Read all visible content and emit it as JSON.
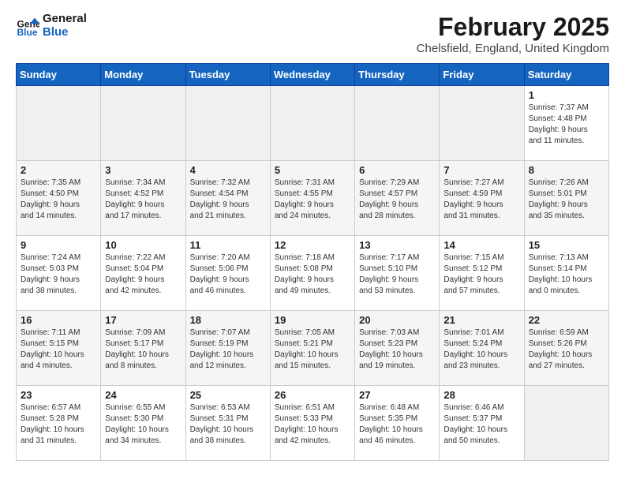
{
  "logo": {
    "line1": "General",
    "line2": "Blue"
  },
  "title": "February 2025",
  "subtitle": "Chelsfield, England, United Kingdom",
  "weekdays": [
    "Sunday",
    "Monday",
    "Tuesday",
    "Wednesday",
    "Thursday",
    "Friday",
    "Saturday"
  ],
  "weeks": [
    [
      {
        "day": "",
        "info": ""
      },
      {
        "day": "",
        "info": ""
      },
      {
        "day": "",
        "info": ""
      },
      {
        "day": "",
        "info": ""
      },
      {
        "day": "",
        "info": ""
      },
      {
        "day": "",
        "info": ""
      },
      {
        "day": "1",
        "info": "Sunrise: 7:37 AM\nSunset: 4:48 PM\nDaylight: 9 hours\nand 11 minutes."
      }
    ],
    [
      {
        "day": "2",
        "info": "Sunrise: 7:35 AM\nSunset: 4:50 PM\nDaylight: 9 hours\nand 14 minutes."
      },
      {
        "day": "3",
        "info": "Sunrise: 7:34 AM\nSunset: 4:52 PM\nDaylight: 9 hours\nand 17 minutes."
      },
      {
        "day": "4",
        "info": "Sunrise: 7:32 AM\nSunset: 4:54 PM\nDaylight: 9 hours\nand 21 minutes."
      },
      {
        "day": "5",
        "info": "Sunrise: 7:31 AM\nSunset: 4:55 PM\nDaylight: 9 hours\nand 24 minutes."
      },
      {
        "day": "6",
        "info": "Sunrise: 7:29 AM\nSunset: 4:57 PM\nDaylight: 9 hours\nand 28 minutes."
      },
      {
        "day": "7",
        "info": "Sunrise: 7:27 AM\nSunset: 4:59 PM\nDaylight: 9 hours\nand 31 minutes."
      },
      {
        "day": "8",
        "info": "Sunrise: 7:26 AM\nSunset: 5:01 PM\nDaylight: 9 hours\nand 35 minutes."
      }
    ],
    [
      {
        "day": "9",
        "info": "Sunrise: 7:24 AM\nSunset: 5:03 PM\nDaylight: 9 hours\nand 38 minutes."
      },
      {
        "day": "10",
        "info": "Sunrise: 7:22 AM\nSunset: 5:04 PM\nDaylight: 9 hours\nand 42 minutes."
      },
      {
        "day": "11",
        "info": "Sunrise: 7:20 AM\nSunset: 5:06 PM\nDaylight: 9 hours\nand 46 minutes."
      },
      {
        "day": "12",
        "info": "Sunrise: 7:18 AM\nSunset: 5:08 PM\nDaylight: 9 hours\nand 49 minutes."
      },
      {
        "day": "13",
        "info": "Sunrise: 7:17 AM\nSunset: 5:10 PM\nDaylight: 9 hours\nand 53 minutes."
      },
      {
        "day": "14",
        "info": "Sunrise: 7:15 AM\nSunset: 5:12 PM\nDaylight: 9 hours\nand 57 minutes."
      },
      {
        "day": "15",
        "info": "Sunrise: 7:13 AM\nSunset: 5:14 PM\nDaylight: 10 hours\nand 0 minutes."
      }
    ],
    [
      {
        "day": "16",
        "info": "Sunrise: 7:11 AM\nSunset: 5:15 PM\nDaylight: 10 hours\nand 4 minutes."
      },
      {
        "day": "17",
        "info": "Sunrise: 7:09 AM\nSunset: 5:17 PM\nDaylight: 10 hours\nand 8 minutes."
      },
      {
        "day": "18",
        "info": "Sunrise: 7:07 AM\nSunset: 5:19 PM\nDaylight: 10 hours\nand 12 minutes."
      },
      {
        "day": "19",
        "info": "Sunrise: 7:05 AM\nSunset: 5:21 PM\nDaylight: 10 hours\nand 15 minutes."
      },
      {
        "day": "20",
        "info": "Sunrise: 7:03 AM\nSunset: 5:23 PM\nDaylight: 10 hours\nand 19 minutes."
      },
      {
        "day": "21",
        "info": "Sunrise: 7:01 AM\nSunset: 5:24 PM\nDaylight: 10 hours\nand 23 minutes."
      },
      {
        "day": "22",
        "info": "Sunrise: 6:59 AM\nSunset: 5:26 PM\nDaylight: 10 hours\nand 27 minutes."
      }
    ],
    [
      {
        "day": "23",
        "info": "Sunrise: 6:57 AM\nSunset: 5:28 PM\nDaylight: 10 hours\nand 31 minutes."
      },
      {
        "day": "24",
        "info": "Sunrise: 6:55 AM\nSunset: 5:30 PM\nDaylight: 10 hours\nand 34 minutes."
      },
      {
        "day": "25",
        "info": "Sunrise: 6:53 AM\nSunset: 5:31 PM\nDaylight: 10 hours\nand 38 minutes."
      },
      {
        "day": "26",
        "info": "Sunrise: 6:51 AM\nSunset: 5:33 PM\nDaylight: 10 hours\nand 42 minutes."
      },
      {
        "day": "27",
        "info": "Sunrise: 6:48 AM\nSunset: 5:35 PM\nDaylight: 10 hours\nand 46 minutes."
      },
      {
        "day": "28",
        "info": "Sunrise: 6:46 AM\nSunset: 5:37 PM\nDaylight: 10 hours\nand 50 minutes."
      },
      {
        "day": "",
        "info": ""
      }
    ]
  ]
}
